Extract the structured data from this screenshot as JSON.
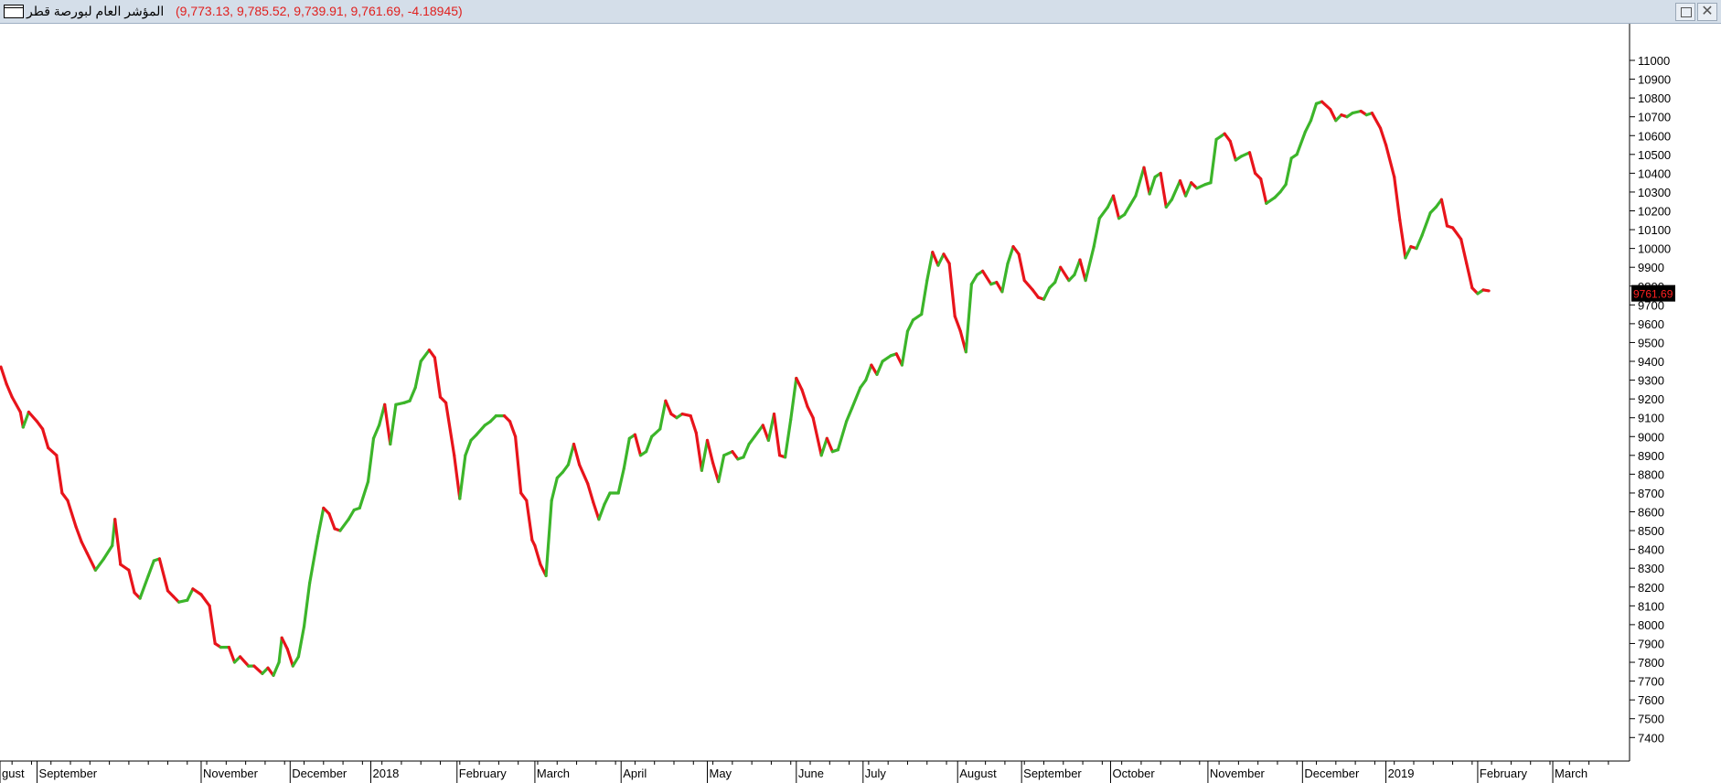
{
  "window": {
    "title_name": "المؤشر العام لبورصة قطر",
    "title_values": "(9,773.13, 9,785.52, 9,739.91, 9,761.69, -4.18945)"
  },
  "colors": {
    "up": "#3cb52a",
    "down": "#e8141b",
    "axis": "#000000",
    "last_price_bg": "#000000",
    "last_price_fg": "#ff2020"
  },
  "chart_data": {
    "type": "line",
    "title": "",
    "xlabel": "",
    "ylabel": "",
    "ylim": [
      7350,
      11100
    ],
    "yticks": [
      7400,
      7500,
      7600,
      7700,
      7800,
      7900,
      8000,
      8100,
      8200,
      8300,
      8400,
      8500,
      8600,
      8700,
      8800,
      8900,
      9000,
      9100,
      9200,
      9300,
      9400,
      9500,
      9600,
      9700,
      9800,
      9900,
      10000,
      10100,
      10200,
      10300,
      10400,
      10500,
      10600,
      10700,
      10800,
      10900,
      11000
    ],
    "x_domain": [
      "2017-08-21",
      "2019-03-25"
    ],
    "xtick_labels": [
      {
        "label": "gust",
        "date": "2017-08-18"
      },
      {
        "label": "September",
        "date": "2017-09-03"
      },
      {
        "label": "November",
        "date": "2017-11-01"
      },
      {
        "label": "December",
        "date": "2017-12-03"
      },
      {
        "label": "2018",
        "date": "2018-01-01"
      },
      {
        "label": "February",
        "date": "2018-02-01"
      },
      {
        "label": "March",
        "date": "2018-03-01"
      },
      {
        "label": "April",
        "date": "2018-04-01"
      },
      {
        "label": "May",
        "date": "2018-05-02"
      },
      {
        "label": "June",
        "date": "2018-06-03"
      },
      {
        "label": "July",
        "date": "2018-06-27"
      },
      {
        "label": "August",
        "date": "2018-07-31"
      },
      {
        "label": "September",
        "date": "2018-08-23"
      },
      {
        "label": "October",
        "date": "2018-09-24"
      },
      {
        "label": "November",
        "date": "2018-10-29"
      },
      {
        "label": "December",
        "date": "2018-12-02"
      },
      {
        "label": "2019",
        "date": "2019-01-01"
      },
      {
        "label": "February",
        "date": "2019-02-03"
      },
      {
        "label": "March",
        "date": "2019-03-02"
      }
    ],
    "last_price": 9761.69,
    "last_price_label": "9761.69",
    "series": [
      {
        "values": [
          [
            "2017-08-21",
            9370
          ],
          [
            "2017-08-23",
            9280
          ],
          [
            "2017-08-25",
            9210
          ],
          [
            "2017-08-28",
            9130
          ],
          [
            "2017-08-29",
            9050
          ],
          [
            "2017-08-31",
            9130
          ],
          [
            "2017-09-03",
            9080
          ],
          [
            "2017-09-05",
            9040
          ],
          [
            "2017-09-07",
            8940
          ],
          [
            "2017-09-10",
            8900
          ],
          [
            "2017-09-12",
            8700
          ],
          [
            "2017-09-14",
            8660
          ],
          [
            "2017-09-17",
            8520
          ],
          [
            "2017-09-19",
            8440
          ],
          [
            "2017-09-21",
            8380
          ],
          [
            "2017-09-24",
            8290
          ],
          [
            "2017-09-27",
            8350
          ],
          [
            "2017-09-30",
            8420
          ],
          [
            "2017-10-01",
            8560
          ],
          [
            "2017-10-03",
            8320
          ],
          [
            "2017-10-06",
            8290
          ],
          [
            "2017-10-08",
            8170
          ],
          [
            "2017-10-10",
            8140
          ],
          [
            "2017-10-13",
            8260
          ],
          [
            "2017-10-15",
            8340
          ],
          [
            "2017-10-17",
            8350
          ],
          [
            "2017-10-20",
            8180
          ],
          [
            "2017-10-22",
            8150
          ],
          [
            "2017-10-24",
            8120
          ],
          [
            "2017-10-27",
            8130
          ],
          [
            "2017-10-29",
            8190
          ],
          [
            "2017-11-01",
            8160
          ],
          [
            "2017-11-04",
            8100
          ],
          [
            "2017-11-06",
            7900
          ],
          [
            "2017-11-08",
            7880
          ],
          [
            "2017-11-11",
            7880
          ],
          [
            "2017-11-13",
            7800
          ],
          [
            "2017-11-15",
            7830
          ],
          [
            "2017-11-18",
            7780
          ],
          [
            "2017-11-20",
            7780
          ],
          [
            "2017-11-23",
            7740
          ],
          [
            "2017-11-25",
            7770
          ],
          [
            "2017-11-27",
            7730
          ],
          [
            "2017-11-29",
            7800
          ],
          [
            "2017-11-30",
            7930
          ],
          [
            "2017-12-02",
            7870
          ],
          [
            "2017-12-04",
            7780
          ],
          [
            "2017-12-06",
            7830
          ],
          [
            "2017-12-08",
            7990
          ],
          [
            "2017-12-10",
            8220
          ],
          [
            "2017-12-13",
            8470
          ],
          [
            "2017-12-15",
            8620
          ],
          [
            "2017-12-17",
            8590
          ],
          [
            "2017-12-19",
            8510
          ],
          [
            "2017-12-21",
            8500
          ],
          [
            "2017-12-24",
            8560
          ],
          [
            "2017-12-26",
            8610
          ],
          [
            "2017-12-28",
            8620
          ],
          [
            "2017-12-31",
            8760
          ],
          [
            "2018-01-02",
            8990
          ],
          [
            "2018-01-04",
            9060
          ],
          [
            "2018-01-06",
            9170
          ],
          [
            "2018-01-08",
            8960
          ],
          [
            "2018-01-10",
            9170
          ],
          [
            "2018-01-13",
            9180
          ],
          [
            "2018-01-15",
            9190
          ],
          [
            "2018-01-17",
            9260
          ],
          [
            "2018-01-19",
            9400
          ],
          [
            "2018-01-22",
            9460
          ],
          [
            "2018-01-24",
            9420
          ],
          [
            "2018-01-26",
            9210
          ],
          [
            "2018-01-28",
            9180
          ],
          [
            "2018-01-31",
            8900
          ],
          [
            "2018-02-02",
            8670
          ],
          [
            "2018-02-04",
            8900
          ],
          [
            "2018-02-06",
            8980
          ],
          [
            "2018-02-08",
            9010
          ],
          [
            "2018-02-11",
            9060
          ],
          [
            "2018-02-13",
            9080
          ],
          [
            "2018-02-15",
            9110
          ],
          [
            "2018-02-18",
            9110
          ],
          [
            "2018-02-20",
            9080
          ],
          [
            "2018-02-22",
            9000
          ],
          [
            "2018-02-24",
            8700
          ],
          [
            "2018-02-26",
            8660
          ],
          [
            "2018-02-28",
            8450
          ],
          [
            "2018-03-01",
            8420
          ],
          [
            "2018-03-03",
            8320
          ],
          [
            "2018-03-05",
            8260
          ],
          [
            "2018-03-07",
            8660
          ],
          [
            "2018-03-09",
            8780
          ],
          [
            "2018-03-11",
            8810
          ],
          [
            "2018-03-13",
            8850
          ],
          [
            "2018-03-15",
            8960
          ],
          [
            "2018-03-17",
            8850
          ],
          [
            "2018-03-20",
            8750
          ],
          [
            "2018-03-22",
            8650
          ],
          [
            "2018-03-24",
            8560
          ],
          [
            "2018-03-26",
            8640
          ],
          [
            "2018-03-28",
            8700
          ],
          [
            "2018-03-31",
            8700
          ],
          [
            "2018-04-02",
            8830
          ],
          [
            "2018-04-04",
            8990
          ],
          [
            "2018-04-06",
            9010
          ],
          [
            "2018-04-08",
            8900
          ],
          [
            "2018-04-10",
            8920
          ],
          [
            "2018-04-12",
            9000
          ],
          [
            "2018-04-15",
            9040
          ],
          [
            "2018-04-17",
            9190
          ],
          [
            "2018-04-19",
            9120
          ],
          [
            "2018-04-21",
            9100
          ],
          [
            "2018-04-23",
            9120
          ],
          [
            "2018-04-26",
            9110
          ],
          [
            "2018-04-28",
            9020
          ],
          [
            "2018-04-30",
            8820
          ],
          [
            "2018-05-02",
            8980
          ],
          [
            "2018-05-04",
            8860
          ],
          [
            "2018-05-06",
            8760
          ],
          [
            "2018-05-08",
            8900
          ],
          [
            "2018-05-11",
            8920
          ],
          [
            "2018-05-13",
            8880
          ],
          [
            "2018-05-15",
            8890
          ],
          [
            "2018-05-17",
            8960
          ],
          [
            "2018-05-19",
            9000
          ],
          [
            "2018-05-22",
            9060
          ],
          [
            "2018-05-24",
            8980
          ],
          [
            "2018-05-26",
            9120
          ],
          [
            "2018-05-28",
            8900
          ],
          [
            "2018-05-30",
            8890
          ],
          [
            "2018-06-01",
            9090
          ],
          [
            "2018-06-03",
            9310
          ],
          [
            "2018-06-05",
            9250
          ],
          [
            "2018-06-07",
            9160
          ],
          [
            "2018-06-09",
            9100
          ],
          [
            "2018-06-12",
            8900
          ],
          [
            "2018-06-14",
            8990
          ],
          [
            "2018-06-16",
            8920
          ],
          [
            "2018-06-18",
            8930
          ],
          [
            "2018-06-21",
            9080
          ],
          [
            "2018-06-23",
            9150
          ],
          [
            "2018-06-26",
            9260
          ],
          [
            "2018-06-28",
            9300
          ],
          [
            "2018-06-30",
            9380
          ],
          [
            "2018-07-02",
            9330
          ],
          [
            "2018-07-04",
            9400
          ],
          [
            "2018-07-07",
            9430
          ],
          [
            "2018-07-09",
            9440
          ],
          [
            "2018-07-11",
            9380
          ],
          [
            "2018-07-13",
            9560
          ],
          [
            "2018-07-15",
            9620
          ],
          [
            "2018-07-18",
            9650
          ],
          [
            "2018-07-20",
            9830
          ],
          [
            "2018-07-22",
            9980
          ],
          [
            "2018-07-24",
            9910
          ],
          [
            "2018-07-26",
            9970
          ],
          [
            "2018-07-28",
            9920
          ],
          [
            "2018-07-30",
            9640
          ],
          [
            "2018-08-01",
            9560
          ],
          [
            "2018-08-03",
            9450
          ],
          [
            "2018-08-05",
            9810
          ],
          [
            "2018-08-07",
            9860
          ],
          [
            "2018-08-09",
            9880
          ],
          [
            "2018-08-12",
            9810
          ],
          [
            "2018-08-14",
            9820
          ],
          [
            "2018-08-16",
            9770
          ],
          [
            "2018-08-18",
            9920
          ],
          [
            "2018-08-20",
            10010
          ],
          [
            "2018-08-22",
            9970
          ],
          [
            "2018-08-24",
            9830
          ],
          [
            "2018-08-27",
            9780
          ],
          [
            "2018-08-29",
            9740
          ],
          [
            "2018-08-31",
            9730
          ],
          [
            "2018-09-02",
            9790
          ],
          [
            "2018-09-04",
            9820
          ],
          [
            "2018-09-06",
            9900
          ],
          [
            "2018-09-09",
            9830
          ],
          [
            "2018-09-11",
            9860
          ],
          [
            "2018-09-13",
            9940
          ],
          [
            "2018-09-15",
            9830
          ],
          [
            "2018-09-18",
            10010
          ],
          [
            "2018-09-20",
            10160
          ],
          [
            "2018-09-23",
            10220
          ],
          [
            "2018-09-25",
            10280
          ],
          [
            "2018-09-27",
            10160
          ],
          [
            "2018-09-29",
            10180
          ],
          [
            "2018-10-01",
            10230
          ],
          [
            "2018-10-03",
            10280
          ],
          [
            "2018-10-06",
            10430
          ],
          [
            "2018-10-08",
            10290
          ],
          [
            "2018-10-10",
            10380
          ],
          [
            "2018-10-12",
            10400
          ],
          [
            "2018-10-14",
            10220
          ],
          [
            "2018-10-16",
            10260
          ],
          [
            "2018-10-19",
            10360
          ],
          [
            "2018-10-21",
            10280
          ],
          [
            "2018-10-23",
            10350
          ],
          [
            "2018-10-25",
            10320
          ],
          [
            "2018-10-28",
            10340
          ],
          [
            "2018-10-30",
            10350
          ],
          [
            "2018-11-01",
            10580
          ],
          [
            "2018-11-04",
            10610
          ],
          [
            "2018-11-06",
            10570
          ],
          [
            "2018-11-08",
            10470
          ],
          [
            "2018-11-10",
            10490
          ],
          [
            "2018-11-13",
            10510
          ],
          [
            "2018-11-15",
            10400
          ],
          [
            "2018-11-17",
            10370
          ],
          [
            "2018-11-19",
            10240
          ],
          [
            "2018-11-22",
            10270
          ],
          [
            "2018-11-24",
            10300
          ],
          [
            "2018-11-26",
            10340
          ],
          [
            "2018-11-28",
            10480
          ],
          [
            "2018-11-30",
            10500
          ],
          [
            "2018-12-03",
            10620
          ],
          [
            "2018-12-05",
            10680
          ],
          [
            "2018-12-07",
            10770
          ],
          [
            "2018-12-09",
            10780
          ],
          [
            "2018-12-12",
            10740
          ],
          [
            "2018-12-14",
            10680
          ],
          [
            "2018-12-16",
            10710
          ],
          [
            "2018-12-18",
            10700
          ],
          [
            "2018-12-20",
            10720
          ],
          [
            "2018-12-23",
            10730
          ],
          [
            "2018-12-25",
            10710
          ],
          [
            "2018-12-27",
            10720
          ],
          [
            "2018-12-30",
            10640
          ],
          [
            "2019-01-01",
            10550
          ],
          [
            "2019-01-04",
            10380
          ],
          [
            "2019-01-06",
            10150
          ],
          [
            "2019-01-08",
            9950
          ],
          [
            "2019-01-10",
            10010
          ],
          [
            "2019-01-12",
            10000
          ],
          [
            "2019-01-14",
            10070
          ],
          [
            "2019-01-17",
            10190
          ],
          [
            "2019-01-19",
            10220
          ],
          [
            "2019-01-21",
            10260
          ],
          [
            "2019-01-23",
            10120
          ],
          [
            "2019-01-25",
            10110
          ],
          [
            "2019-01-28",
            10050
          ],
          [
            "2019-01-30",
            9920
          ],
          [
            "2019-02-01",
            9790
          ],
          [
            "2019-02-03",
            9760
          ],
          [
            "2019-02-05",
            9780
          ],
          [
            "2019-02-07",
            9775
          ]
        ]
      }
    ]
  }
}
